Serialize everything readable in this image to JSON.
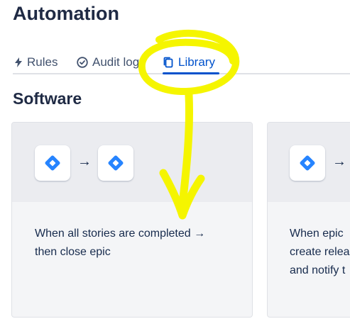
{
  "header": {
    "title": "Automation"
  },
  "tabs": [
    {
      "label": "Rules",
      "icon": "bolt-icon"
    },
    {
      "label": "Audit log",
      "icon": "check-circle-icon"
    },
    {
      "label": "Library",
      "icon": "copy-icon",
      "active": true
    }
  ],
  "section": {
    "title": "Software"
  },
  "cards": [
    {
      "trigger_icon": "jira-icon",
      "action_icon": "jira-icon",
      "arrow": "→",
      "desc_line1": "When all stories are completed →",
      "desc_line2": "then close epic"
    },
    {
      "trigger_icon": "jira-icon",
      "arrow": "→",
      "desc_line1": "When epic",
      "desc_line2": "create relea",
      "desc_line3": "and notify t"
    }
  ],
  "colors": {
    "accent": "#0052cc",
    "jira_blue": "#2684ff",
    "annotation_yellow": "#f5f500"
  }
}
